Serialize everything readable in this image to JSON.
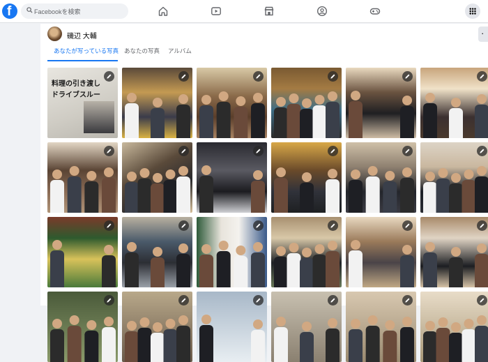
{
  "header": {
    "search_placeholder": "Facebookを検索",
    "logo_letter": "f"
  },
  "profile": {
    "name": "磯辺 大輔"
  },
  "tabs": [
    {
      "label": "あなたが写っている写真",
      "active": true
    },
    {
      "label": "あなたの写真",
      "active": false
    },
    {
      "label": "アルバム",
      "active": false
    }
  ],
  "colors": {
    "brand": "#1877f2",
    "text_secondary": "#65676b"
  },
  "photos": [
    {
      "id": "p1"
    },
    {
      "id": "p2"
    },
    {
      "id": "p3"
    },
    {
      "id": "p4"
    },
    {
      "id": "p5"
    },
    {
      "id": "p6"
    },
    {
      "id": "p7"
    },
    {
      "id": "p8"
    },
    {
      "id": "p9"
    },
    {
      "id": "p10"
    },
    {
      "id": "p11"
    },
    {
      "id": "p12"
    },
    {
      "id": "p13"
    },
    {
      "id": "p14"
    },
    {
      "id": "p15"
    },
    {
      "id": "p16"
    },
    {
      "id": "p17"
    },
    {
      "id": "p18"
    },
    {
      "id": "p19"
    },
    {
      "id": "p20"
    },
    {
      "id": "p21"
    },
    {
      "id": "p22"
    },
    {
      "id": "p23"
    },
    {
      "id": "p24"
    }
  ],
  "photo_text": {
    "newspaper_headline_1": "料理の引き渡し",
    "newspaper_headline_2": "ドライブスルー"
  }
}
